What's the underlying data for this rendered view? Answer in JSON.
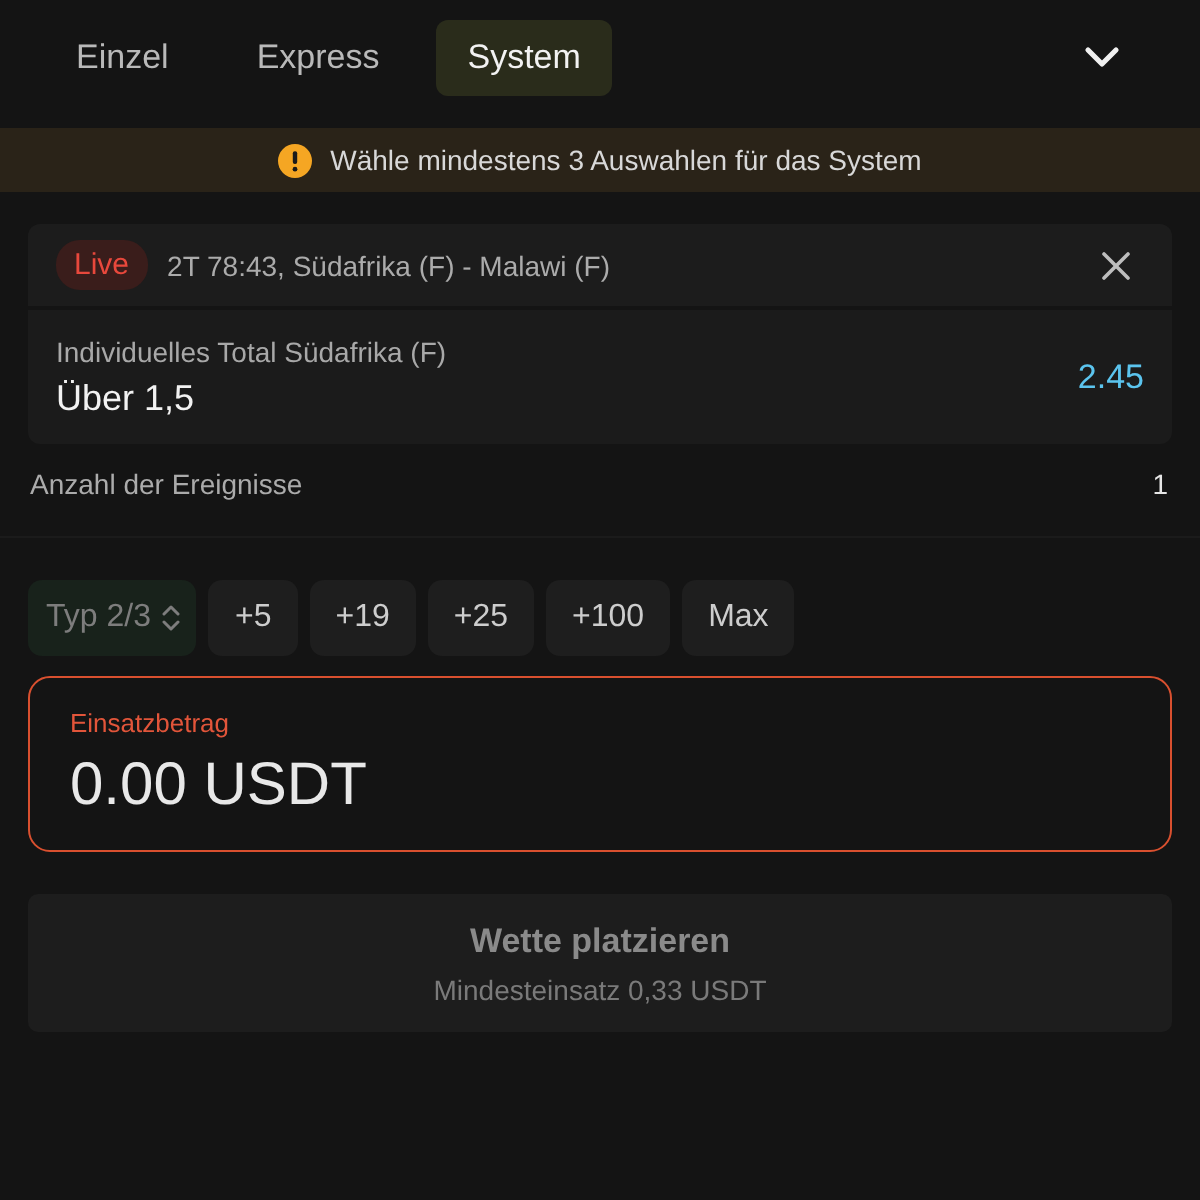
{
  "tabs": [
    {
      "label": "Einzel",
      "selected": false
    },
    {
      "label": "Express",
      "selected": false
    },
    {
      "label": "System",
      "selected": true
    }
  ],
  "warning": {
    "text": "Wähle mindestens 3 Auswahlen für das System"
  },
  "bets": [
    {
      "live": true,
      "badge": "Live",
      "event": "2T 78:43, Südafrika (F) - Malawi (F)",
      "market": "Individuelles Total Südafrika (F)",
      "selection": "Über 1,5",
      "odds": "2.45"
    }
  ],
  "summary": {
    "label": "Anzahl der Ereignisse",
    "value": "1"
  },
  "system_type": {
    "label": "Typ 2/3",
    "disabled": true
  },
  "quick_amounts": [
    "+5",
    "+19",
    "+25",
    "+100",
    "Max"
  ],
  "stake": {
    "label": "Einsatzbetrag",
    "value": "0.00 USDT",
    "invalid": true
  },
  "place_bet": {
    "label": "Wette platzieren",
    "sublabel": "Mindesteinsatz 0,33 USDT",
    "disabled": true
  }
}
